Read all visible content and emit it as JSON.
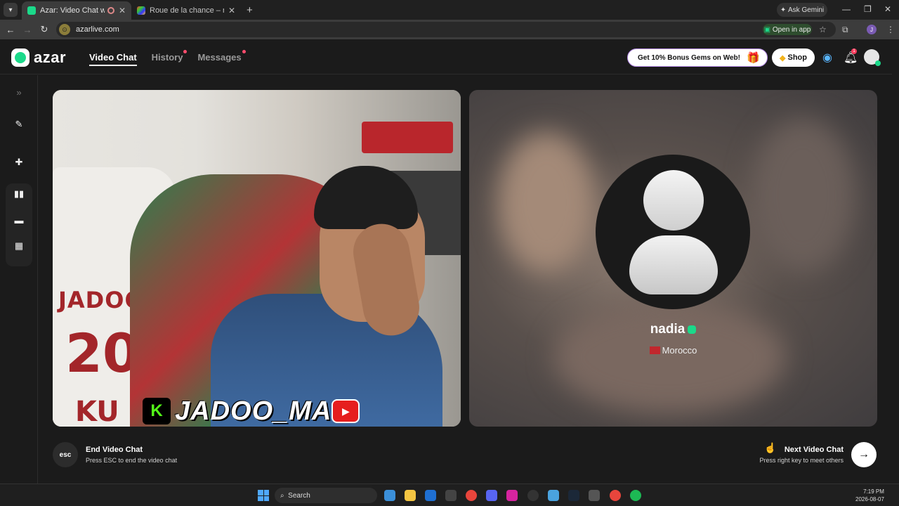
{
  "browser": {
    "tabs": [
      {
        "title": "Azar: Video Chat with New",
        "active": true
      },
      {
        "title": "Roue de la chance – roue aléato",
        "active": false
      }
    ],
    "ask_gemini": "Ask Gemini",
    "url": "azarlive.com",
    "open_in_app": "Open in app",
    "profile_initial": "J"
  },
  "header": {
    "logo_text": "azar",
    "nav": [
      {
        "label": "Video Chat",
        "active": true,
        "dot": false
      },
      {
        "label": "History",
        "active": false,
        "dot": true
      },
      {
        "label": "Messages",
        "active": false,
        "dot": true
      }
    ],
    "bonus_label": "Get 10% Bonus Gems on Web!",
    "shop_label": "Shop",
    "notification_count": "1",
    "accent_color": "#1bd98a"
  },
  "local_video": {
    "jersey_name": "JADOO",
    "jersey_number": "20",
    "jersey_ku": "KU",
    "watermark_k": "K",
    "watermark_text": "JADOO_MA"
  },
  "peer": {
    "name": "nadia",
    "country": "Morocco"
  },
  "footer": {
    "esc_key": "esc",
    "end_title": "End Video Chat",
    "end_sub": "Press ESC to end the video chat",
    "next_title": "Next Video Chat",
    "next_sub": "Press right key to meet others"
  },
  "taskbar": {
    "search_placeholder": "Search",
    "time": "7:19 PM",
    "date": "2026-08-07"
  }
}
